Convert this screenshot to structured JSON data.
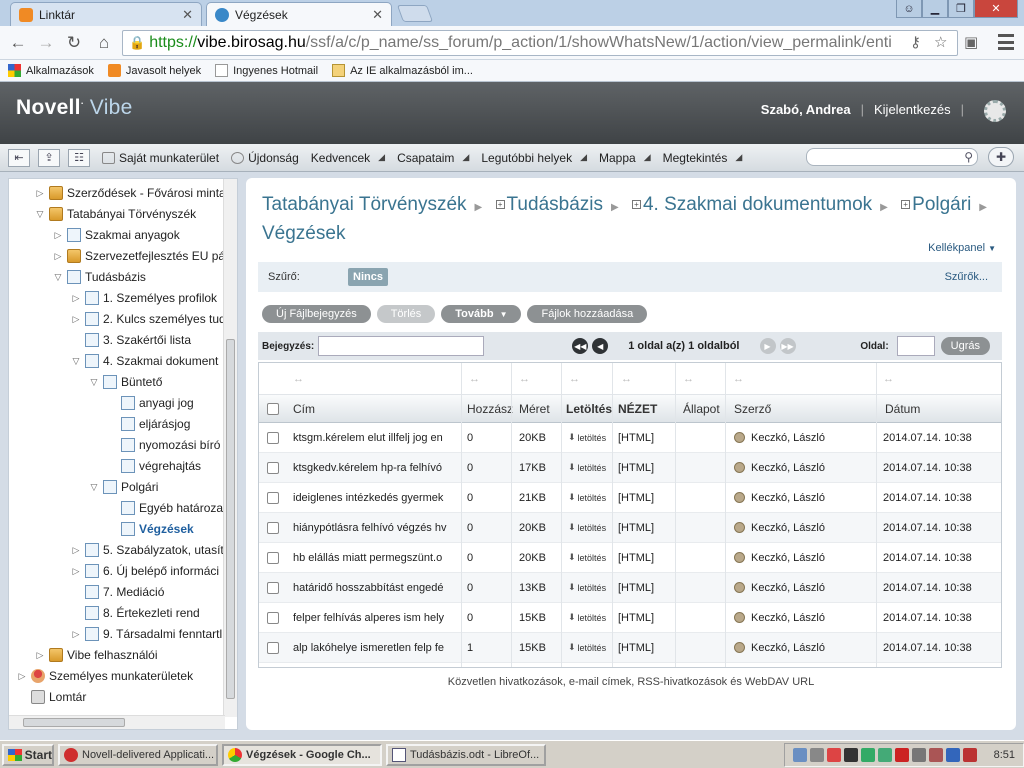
{
  "browser": {
    "tabs": [
      {
        "label": "Linktár",
        "active": false
      },
      {
        "label": "Végzések",
        "active": true
      }
    ],
    "url": {
      "scheme": "https://",
      "host": "vibe.birosag.hu",
      "path": "/ssf/a/c/p_name/ss_forum/p_action/1/showWhatsNew/1/action/view_permalink/enti"
    },
    "bookmarks": [
      "Alkalmazások",
      "Javasolt helyek",
      "Ingyenes Hotmail",
      "Az IE alkalmazásból im..."
    ]
  },
  "vibe": {
    "logo_brand": "Novell",
    "logo_product": "Vibe",
    "user_name": "Szabó, Andrea",
    "logout_label": "Kijelentkezés",
    "menu": [
      "Saját munkaterület",
      "Újdonság",
      "Kedvencek",
      "Csapataim",
      "Legutóbbi helyek",
      "Mappa",
      "Megtekintés"
    ]
  },
  "sidebar": {
    "items": [
      {
        "label": "Szerződések - Fővárosi minta",
        "level": 1,
        "icon": "folder",
        "toggle": "▷"
      },
      {
        "label": "Tatabányai Törvényszék",
        "level": 1,
        "icon": "folder",
        "toggle": "▽"
      },
      {
        "label": "Szakmai anyagok",
        "level": 2,
        "icon": "page",
        "toggle": "▷"
      },
      {
        "label": "Szervezetfejlesztés EU pá",
        "level": 2,
        "icon": "folder",
        "toggle": "▷"
      },
      {
        "label": "Tudásbázis",
        "level": 2,
        "icon": "page",
        "toggle": "▽"
      },
      {
        "label": "1. Személyes profilok",
        "level": 3,
        "icon": "page",
        "toggle": "▷"
      },
      {
        "label": "2. Kulcs személyes tud",
        "level": 3,
        "icon": "page",
        "toggle": "▷"
      },
      {
        "label": "3. Szakértői lista",
        "level": 3,
        "icon": "page",
        "toggle": ""
      },
      {
        "label": "4. Szakmai dokument",
        "level": 3,
        "icon": "page",
        "toggle": "▽"
      },
      {
        "label": "Büntető",
        "level": 4,
        "icon": "page",
        "toggle": "▽"
      },
      {
        "label": "anyagi jog",
        "level": 5,
        "icon": "page",
        "toggle": ""
      },
      {
        "label": "eljárásjog",
        "level": 5,
        "icon": "page",
        "toggle": ""
      },
      {
        "label": "nyomozási bíró",
        "level": 5,
        "icon": "page",
        "toggle": ""
      },
      {
        "label": "végrehajtás",
        "level": 5,
        "icon": "page",
        "toggle": ""
      },
      {
        "label": "Polgári",
        "level": 4,
        "icon": "page",
        "toggle": "▽"
      },
      {
        "label": "Egyéb határozato",
        "level": 5,
        "icon": "page",
        "toggle": ""
      },
      {
        "label": "Végzések",
        "level": 5,
        "icon": "page",
        "toggle": "",
        "selected": true
      },
      {
        "label": "5. Szabályzatok, utasítá",
        "level": 3,
        "icon": "page",
        "toggle": "▷"
      },
      {
        "label": "6. Új belépő informáci",
        "level": 3,
        "icon": "page",
        "toggle": "▷"
      },
      {
        "label": "7. Mediáció",
        "level": 3,
        "icon": "page",
        "toggle": ""
      },
      {
        "label": "8. Értekezleti rend",
        "level": 3,
        "icon": "page",
        "toggle": ""
      },
      {
        "label": "9. Társadalmi fenntartl",
        "level": 3,
        "icon": "page",
        "toggle": "▷"
      },
      {
        "label": "Vibe felhasználói",
        "level": 1,
        "icon": "folder",
        "toggle": "▷"
      },
      {
        "label": "Személyes munkaterületek",
        "level": 0,
        "icon": "user",
        "toggle": "▷"
      },
      {
        "label": "Lomtár",
        "level": 0,
        "icon": "trash",
        "toggle": ""
      }
    ]
  },
  "main": {
    "breadcrumbs": [
      "Tatabányai Törvényszék",
      "Tudásbázis",
      "4. Szakmai dokumentumok",
      "Polgári"
    ],
    "title": "Végzések",
    "kellekpanel": "Kellékpanel",
    "filter_label": "Szűrő:",
    "filter_value": "Nincs",
    "filters_link": "Szűrők...",
    "actions": {
      "new": "Új Fájlbejegyzés",
      "delete": "Törlés",
      "more": "Tovább",
      "add_files": "Fájlok hozzáadása"
    },
    "pager": {
      "entry_label": "Bejegyzés:",
      "page_text": "1 oldal a(z) 1 oldalból",
      "page_label": "Oldal:",
      "go": "Ugrás"
    },
    "columns": [
      "Cím",
      "Hozzász",
      "Méret",
      "Letöltés",
      "NÉZET",
      "Állapot",
      "Szerző",
      "Dátum"
    ],
    "rows": [
      {
        "title": "ktsgm.kérelem elut illfelj jog en",
        "comments": "0",
        "size": "20KB",
        "download": "letöltés",
        "view": "[HTML]",
        "status": "",
        "author": "Keczkó, László",
        "date": "2014.07.14. 10:38"
      },
      {
        "title": "ktsgkedv.kérelem hp-ra felhívó",
        "comments": "0",
        "size": "17KB",
        "download": "letöltés",
        "view": "[HTML]",
        "status": "",
        "author": "Keczkó, László",
        "date": "2014.07.14. 10:38"
      },
      {
        "title": "ideiglenes intézkedés gyermek",
        "comments": "0",
        "size": "21KB",
        "download": "letöltés",
        "view": "[HTML]",
        "status": "",
        "author": "Keczkó, László",
        "date": "2014.07.14. 10:38"
      },
      {
        "title": "hiánypótlásra felhívó végzés hv",
        "comments": "0",
        "size": "20KB",
        "download": "letöltés",
        "view": "[HTML]",
        "status": "",
        "author": "Keczkó, László",
        "date": "2014.07.14. 10:38"
      },
      {
        "title": "hb elállás miatt permegszünt.o",
        "comments": "0",
        "size": "20KB",
        "download": "letöltés",
        "view": "[HTML]",
        "status": "",
        "author": "Keczkó, László",
        "date": "2014.07.14. 10:38"
      },
      {
        "title": "határidő hosszabbítást engedé",
        "comments": "0",
        "size": "13KB",
        "download": "letöltés",
        "view": "[HTML]",
        "status": "",
        "author": "Keczkó, László",
        "date": "2014.07.14. 10:38"
      },
      {
        "title": "felper felhívás alperes ism hely",
        "comments": "0",
        "size": "15KB",
        "download": "letöltés",
        "view": "[HTML]",
        "status": "",
        "author": "Keczkó, László",
        "date": "2014.07.14. 10:38"
      },
      {
        "title": "alp lakóhelye ismeretlen felp fe",
        "comments": "1",
        "size": "15KB",
        "download": "letöltés",
        "view": "[HTML]",
        "status": "",
        "author": "Keczkó, László",
        "date": "2014.07.14. 10:38"
      }
    ],
    "footer_links": "Közvetlen hivatkozások, e-mail címek, RSS-hivatkozások és WebDAV URL"
  },
  "taskbar": {
    "start": "Start",
    "tasks": [
      {
        "label": "Novell-delivered Applicati...",
        "active": false
      },
      {
        "label": "Végzések - Google Ch...",
        "active": true
      },
      {
        "label": "Tudásbázis.odt - LibreOf...",
        "active": false
      }
    ],
    "clock": "8:51"
  },
  "colors": {
    "accent": "#3a7490",
    "header": "#4d5154",
    "selected": "#1f5f9f"
  }
}
